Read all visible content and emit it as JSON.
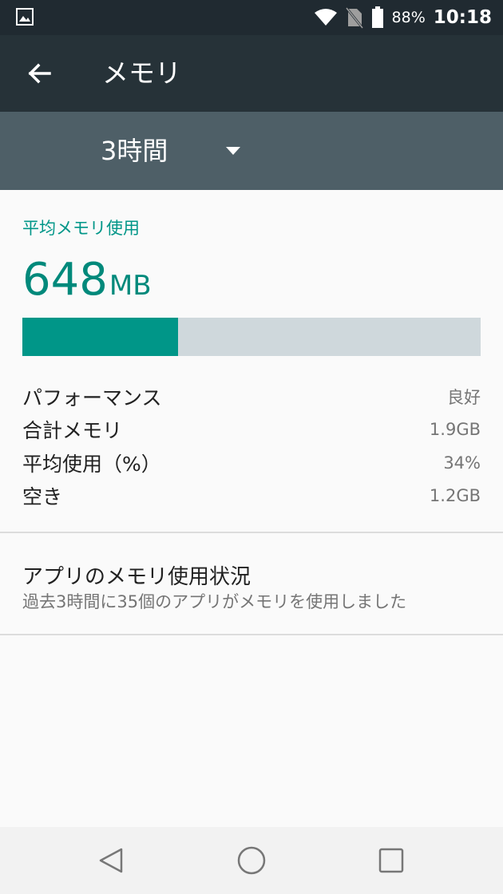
{
  "status_bar": {
    "battery_percent": "88%",
    "time": "10:18",
    "icons": [
      "image-notification-icon",
      "wifi-icon",
      "no-sim-icon",
      "battery-icon"
    ]
  },
  "app_bar": {
    "title": "メモリ",
    "back_icon": "arrow-left-icon"
  },
  "period_selector": {
    "selected": "3時間",
    "icon": "caret-down-icon"
  },
  "average_memory": {
    "label": "平均メモリ使用",
    "value": "648",
    "unit": "MB",
    "usage_fraction": 0.34
  },
  "stats": [
    {
      "label": "パフォーマンス",
      "value": "良好"
    },
    {
      "label": "合計メモリ",
      "value": "1.9GB"
    },
    {
      "label": "平均使用（%）",
      "value": "34%"
    },
    {
      "label": "空き",
      "value": "1.2GB"
    }
  ],
  "app_memory": {
    "title": "アプリのメモリ使用状況",
    "subtitle": "過去3時間に35個のアプリがメモリを使用しました"
  },
  "nav_bar": {
    "icons": [
      "back-triangle-icon",
      "home-circle-icon",
      "recents-square-icon"
    ]
  },
  "colors": {
    "accent": "#009688",
    "app_bar": "#263238",
    "status_bar": "#202a31",
    "period_bar": "#4e5f67",
    "bar_track": "#cfd8dc"
  }
}
